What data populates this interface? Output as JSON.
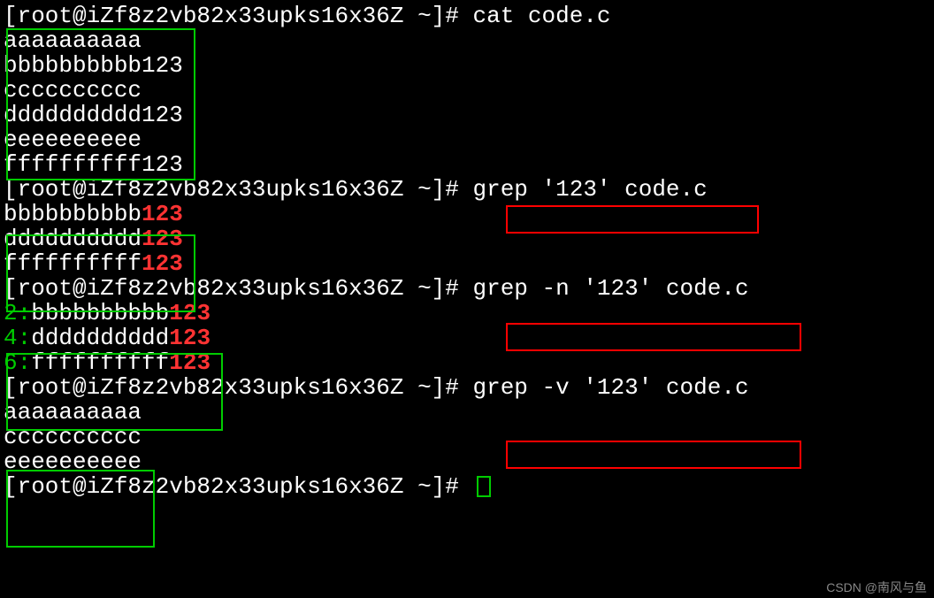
{
  "prompt": "[root@iZf8z2vb82x33upks16x36Z ~]# ",
  "cmd1": "cat code.c",
  "cat_output": {
    "l1": "aaaaaaaaaa",
    "l2": "bbbbbbbbbb123",
    "l3": "cccccccccc",
    "l4": "dddddddddd123",
    "l5": "eeeeeeeeee",
    "l6": "ffffffffff123"
  },
  "cmd2": "grep '123' code.c",
  "grep1": {
    "r1_pre": "bbbbbbbbbb",
    "r1_match": "123",
    "r2_pre": "dddddddddd",
    "r2_match": "123",
    "r3_pre": "ffffffffff",
    "r3_match": "123"
  },
  "cmd3": "grep -n '123' code.c",
  "grep2": {
    "r1_num": "2",
    "r1_pre": "bbbbbbbbbb",
    "r1_match": "123",
    "r2_num": "4",
    "r2_pre": "dddddddddd",
    "r2_match": "123",
    "r3_num": "6",
    "r3_pre": "ffffffffff",
    "r3_match": "123",
    "colon": ":"
  },
  "cmd4": "grep -v '123' code.c",
  "grep3": {
    "r1": "aaaaaaaaaa",
    "r2": "cccccccccc",
    "r3": "eeeeeeeeee"
  },
  "watermark": "CSDN @南风与鱼"
}
